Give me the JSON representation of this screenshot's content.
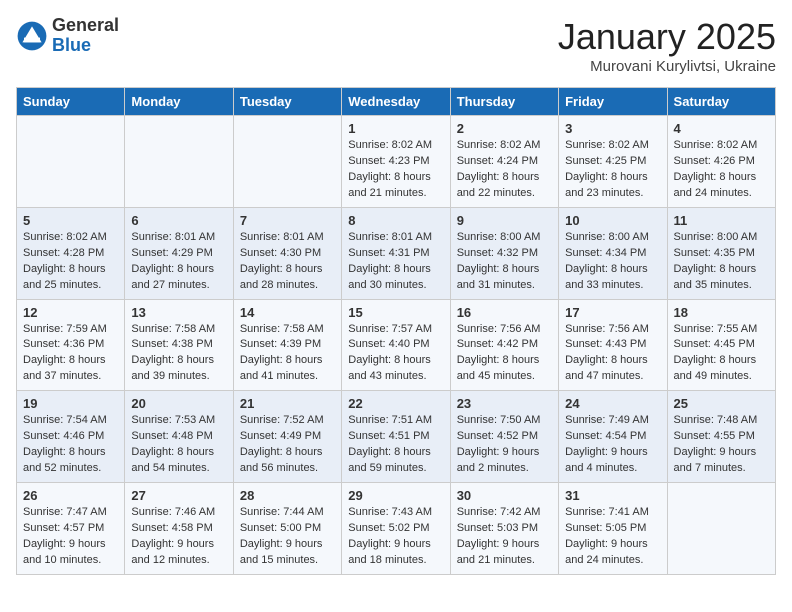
{
  "header": {
    "logo_general": "General",
    "logo_blue": "Blue",
    "month_title": "January 2025",
    "subtitle": "Murovani Kurylivtsi, Ukraine"
  },
  "days_of_week": [
    "Sunday",
    "Monday",
    "Tuesday",
    "Wednesday",
    "Thursday",
    "Friday",
    "Saturday"
  ],
  "weeks": [
    [
      {
        "day": "",
        "info": ""
      },
      {
        "day": "",
        "info": ""
      },
      {
        "day": "",
        "info": ""
      },
      {
        "day": "1",
        "info": "Sunrise: 8:02 AM\nSunset: 4:23 PM\nDaylight: 8 hours and 21 minutes."
      },
      {
        "day": "2",
        "info": "Sunrise: 8:02 AM\nSunset: 4:24 PM\nDaylight: 8 hours and 22 minutes."
      },
      {
        "day": "3",
        "info": "Sunrise: 8:02 AM\nSunset: 4:25 PM\nDaylight: 8 hours and 23 minutes."
      },
      {
        "day": "4",
        "info": "Sunrise: 8:02 AM\nSunset: 4:26 PM\nDaylight: 8 hours and 24 minutes."
      }
    ],
    [
      {
        "day": "5",
        "info": "Sunrise: 8:02 AM\nSunset: 4:28 PM\nDaylight: 8 hours and 25 minutes."
      },
      {
        "day": "6",
        "info": "Sunrise: 8:01 AM\nSunset: 4:29 PM\nDaylight: 8 hours and 27 minutes."
      },
      {
        "day": "7",
        "info": "Sunrise: 8:01 AM\nSunset: 4:30 PM\nDaylight: 8 hours and 28 minutes."
      },
      {
        "day": "8",
        "info": "Sunrise: 8:01 AM\nSunset: 4:31 PM\nDaylight: 8 hours and 30 minutes."
      },
      {
        "day": "9",
        "info": "Sunrise: 8:00 AM\nSunset: 4:32 PM\nDaylight: 8 hours and 31 minutes."
      },
      {
        "day": "10",
        "info": "Sunrise: 8:00 AM\nSunset: 4:34 PM\nDaylight: 8 hours and 33 minutes."
      },
      {
        "day": "11",
        "info": "Sunrise: 8:00 AM\nSunset: 4:35 PM\nDaylight: 8 hours and 35 minutes."
      }
    ],
    [
      {
        "day": "12",
        "info": "Sunrise: 7:59 AM\nSunset: 4:36 PM\nDaylight: 8 hours and 37 minutes."
      },
      {
        "day": "13",
        "info": "Sunrise: 7:58 AM\nSunset: 4:38 PM\nDaylight: 8 hours and 39 minutes."
      },
      {
        "day": "14",
        "info": "Sunrise: 7:58 AM\nSunset: 4:39 PM\nDaylight: 8 hours and 41 minutes."
      },
      {
        "day": "15",
        "info": "Sunrise: 7:57 AM\nSunset: 4:40 PM\nDaylight: 8 hours and 43 minutes."
      },
      {
        "day": "16",
        "info": "Sunrise: 7:56 AM\nSunset: 4:42 PM\nDaylight: 8 hours and 45 minutes."
      },
      {
        "day": "17",
        "info": "Sunrise: 7:56 AM\nSunset: 4:43 PM\nDaylight: 8 hours and 47 minutes."
      },
      {
        "day": "18",
        "info": "Sunrise: 7:55 AM\nSunset: 4:45 PM\nDaylight: 8 hours and 49 minutes."
      }
    ],
    [
      {
        "day": "19",
        "info": "Sunrise: 7:54 AM\nSunset: 4:46 PM\nDaylight: 8 hours and 52 minutes."
      },
      {
        "day": "20",
        "info": "Sunrise: 7:53 AM\nSunset: 4:48 PM\nDaylight: 8 hours and 54 minutes."
      },
      {
        "day": "21",
        "info": "Sunrise: 7:52 AM\nSunset: 4:49 PM\nDaylight: 8 hours and 56 minutes."
      },
      {
        "day": "22",
        "info": "Sunrise: 7:51 AM\nSunset: 4:51 PM\nDaylight: 8 hours and 59 minutes."
      },
      {
        "day": "23",
        "info": "Sunrise: 7:50 AM\nSunset: 4:52 PM\nDaylight: 9 hours and 2 minutes."
      },
      {
        "day": "24",
        "info": "Sunrise: 7:49 AM\nSunset: 4:54 PM\nDaylight: 9 hours and 4 minutes."
      },
      {
        "day": "25",
        "info": "Sunrise: 7:48 AM\nSunset: 4:55 PM\nDaylight: 9 hours and 7 minutes."
      }
    ],
    [
      {
        "day": "26",
        "info": "Sunrise: 7:47 AM\nSunset: 4:57 PM\nDaylight: 9 hours and 10 minutes."
      },
      {
        "day": "27",
        "info": "Sunrise: 7:46 AM\nSunset: 4:58 PM\nDaylight: 9 hours and 12 minutes."
      },
      {
        "day": "28",
        "info": "Sunrise: 7:44 AM\nSunset: 5:00 PM\nDaylight: 9 hours and 15 minutes."
      },
      {
        "day": "29",
        "info": "Sunrise: 7:43 AM\nSunset: 5:02 PM\nDaylight: 9 hours and 18 minutes."
      },
      {
        "day": "30",
        "info": "Sunrise: 7:42 AM\nSunset: 5:03 PM\nDaylight: 9 hours and 21 minutes."
      },
      {
        "day": "31",
        "info": "Sunrise: 7:41 AM\nSunset: 5:05 PM\nDaylight: 9 hours and 24 minutes."
      },
      {
        "day": "",
        "info": ""
      }
    ]
  ]
}
